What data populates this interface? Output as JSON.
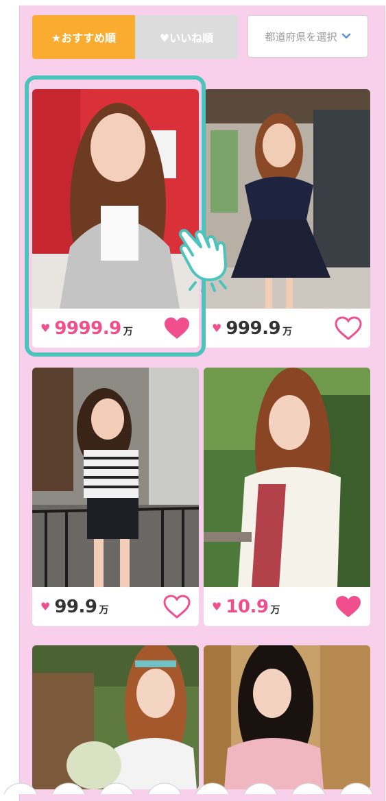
{
  "sort_tabs": {
    "recommended": "★おすすめ順",
    "likes": "♥いいね順"
  },
  "prefecture_select": {
    "placeholder": "都道府県を選択"
  },
  "cards": [
    {
      "count": "9999.9",
      "unit": "万",
      "liked": true
    },
    {
      "count": "999.9",
      "unit": "万",
      "liked": false
    },
    {
      "count": "99.9",
      "unit": "万",
      "liked": false
    },
    {
      "count": "10.9",
      "unit": "万",
      "liked": true
    }
  ],
  "colors": {
    "background": "#f9d0ec",
    "accent_orange": "#f9ac2f",
    "heart_pink": "#f14e8e",
    "highlight_teal": "#4cc4bd"
  },
  "icons": [
    "star-icon",
    "heart-icon",
    "chevron-down-icon",
    "hand-pointer-icon"
  ]
}
